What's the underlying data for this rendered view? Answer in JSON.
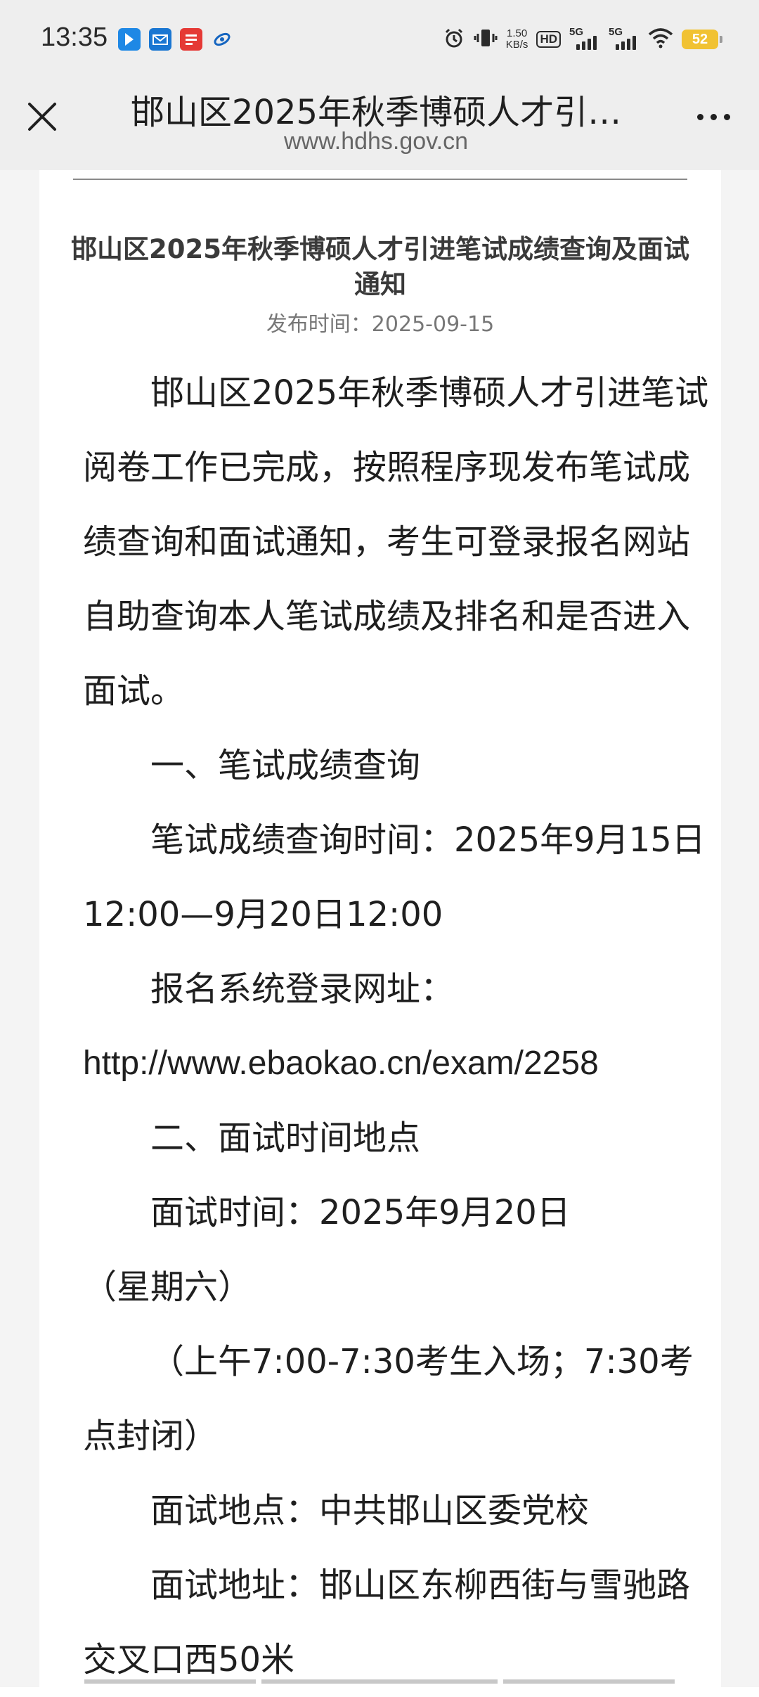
{
  "status_bar": {
    "time": "13:35",
    "net_speed_value": "1.50",
    "net_speed_unit": "KB/s",
    "hd_label": "HD",
    "network_label": "5G",
    "battery": "52"
  },
  "header": {
    "title": "邯山区2025年秋季博硕人才引…",
    "url": "www.hdhs.gov.cn"
  },
  "article": {
    "title": "邯山区2025年秋季博硕人才引进笔试成绩查询及面试通知",
    "date": "发布时间：2025-09-15",
    "paragraphs": [
      "邯山区2025年秋季博硕人才引进笔试阅卷工作已完成，按照程序现发布笔试成绩查询和面试通知，考生可登录报名网站自助查询本人笔试成绩及排名和是否进入面试。",
      "一、笔试成绩查询",
      "笔试成绩查询时间：2025年9月15日12:00—9月20日12:00",
      "报名系统登录网址：",
      "http://www.ebaokao.cn/exam/2258",
      "二、面试时间地点",
      "面试时间：2025年9月20日",
      "（星期六）",
      "（上午7:00-7:30考生入场；7:30考点封闭）",
      "面试地点：中共邯山区委党校",
      "面试地址：邯山区东柳西街与雪驰路交叉口西50米"
    ]
  }
}
